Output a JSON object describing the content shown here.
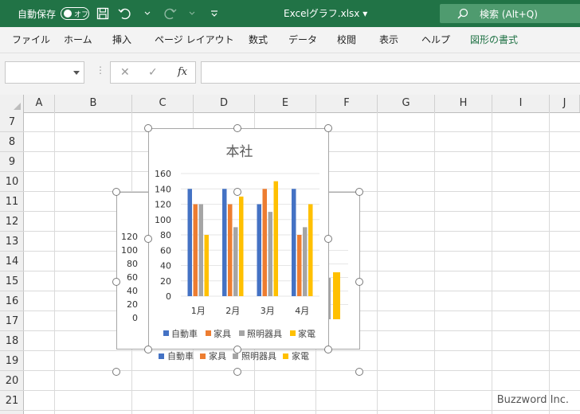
{
  "titlebar": {
    "autosave_label": "自動保存",
    "autosave_toggle": "オフ",
    "document_title": "Excelグラフ.xlsx",
    "document_caret": "▾",
    "search_label": "検索 (Alt+Q)"
  },
  "ribbon": {
    "tabs": [
      "ファイル",
      "ホーム",
      "挿入",
      "ページ レイアウト",
      "数式",
      "データ",
      "校閲",
      "表示",
      "ヘルプ",
      "図形の書式"
    ]
  },
  "formula_bar": {
    "name_box_value": "",
    "dots": "⋮",
    "cancel_symbol": "✕",
    "enter_symbol": "✓",
    "fx_label": "fx",
    "formula_value": ""
  },
  "grid": {
    "columns": [
      "A",
      "B",
      "C",
      "D",
      "E",
      "F",
      "G",
      "H",
      "I",
      "J"
    ],
    "rows": [
      "7",
      "8",
      "9",
      "10",
      "11",
      "12",
      "13",
      "14",
      "15",
      "16",
      "17",
      "18",
      "19",
      "20",
      "21"
    ]
  },
  "colors": {
    "excel_green": "#217346",
    "series": [
      "#4472C4",
      "#ED7D31",
      "#A5A5A5",
      "#FFC000"
    ]
  },
  "back_chart": {
    "y_ticks": [
      "120",
      "100",
      "80",
      "60",
      "40",
      "20",
      "0"
    ],
    "legend": [
      "自動車",
      "家具",
      "照明器具",
      "家電"
    ]
  },
  "chart_data": {
    "type": "bar",
    "title": "本社",
    "categories": [
      "1月",
      "2月",
      "3月",
      "4月"
    ],
    "series": [
      {
        "name": "自動車",
        "values": [
          140,
          140,
          120,
          140
        ]
      },
      {
        "name": "家具",
        "values": [
          120,
          120,
          140,
          80
        ]
      },
      {
        "name": "照明器具",
        "values": [
          120,
          90,
          110,
          90
        ]
      },
      {
        "name": "家電",
        "values": [
          80,
          130,
          150,
          120
        ]
      }
    ],
    "y_ticks": [
      "160",
      "140",
      "120",
      "100",
      "80",
      "60",
      "40",
      "20",
      "0"
    ],
    "ylim": [
      0,
      160
    ],
    "grid": true,
    "legend_position": "bottom"
  },
  "watermark": "Buzzword Inc."
}
